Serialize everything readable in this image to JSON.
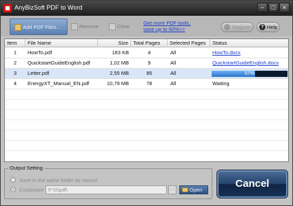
{
  "window": {
    "title": "AnyBizSoft PDF to Word",
    "controls": {
      "minimize": "−",
      "maximize": "□",
      "close": "×"
    }
  },
  "toolbar": {
    "add_label": "Add PDF Files...",
    "remove_label": "Remove",
    "clear_label": "Clear",
    "promo_line1": "Get more PDF tools,",
    "promo_line2": "save up to 60%>>",
    "register_label": "Register",
    "help_label": "Help"
  },
  "table": {
    "headers": {
      "item": "Item",
      "file_name": "File Name",
      "size": "Size",
      "total_pages": "Total Pages",
      "selected_pages": "Selected Pages",
      "status": "Status"
    },
    "rows": [
      {
        "item": "1",
        "file_name": "HowTo.pdf",
        "size": "183  KB",
        "total_pages": "4",
        "selected_pages": "All",
        "status": "HowTo.docx"
      },
      {
        "item": "2",
        "file_name": "QuickstartGuideEnglish.pdf",
        "size": "1,02  MB",
        "total_pages": "9",
        "selected_pages": "All",
        "status": "QuickstartGuideEnglish.docx"
      },
      {
        "item": "3",
        "file_name": "Letter.pdf",
        "size": "2,55  MB",
        "total_pages": "85",
        "selected_pages": "All",
        "status": "57%",
        "progress": 0.57
      },
      {
        "item": "4",
        "file_name": "EnergyXT_Manual_EN.pdf",
        "size": "10,79  MB",
        "total_pages": "78",
        "selected_pages": "All",
        "status": "Waiting"
      }
    ]
  },
  "output": {
    "legend": "Output Setting",
    "same_folder_label": "Save in the same folder as source",
    "customize_label": "Customize",
    "path_value": "P:\\0\\pdf\\",
    "browse_label": "...",
    "open_label": "Open"
  },
  "cancel_label": "Cancel",
  "colors": {
    "accent": "#2d4f80",
    "link": "#1a3bd0",
    "progress": "#2a74cc"
  }
}
